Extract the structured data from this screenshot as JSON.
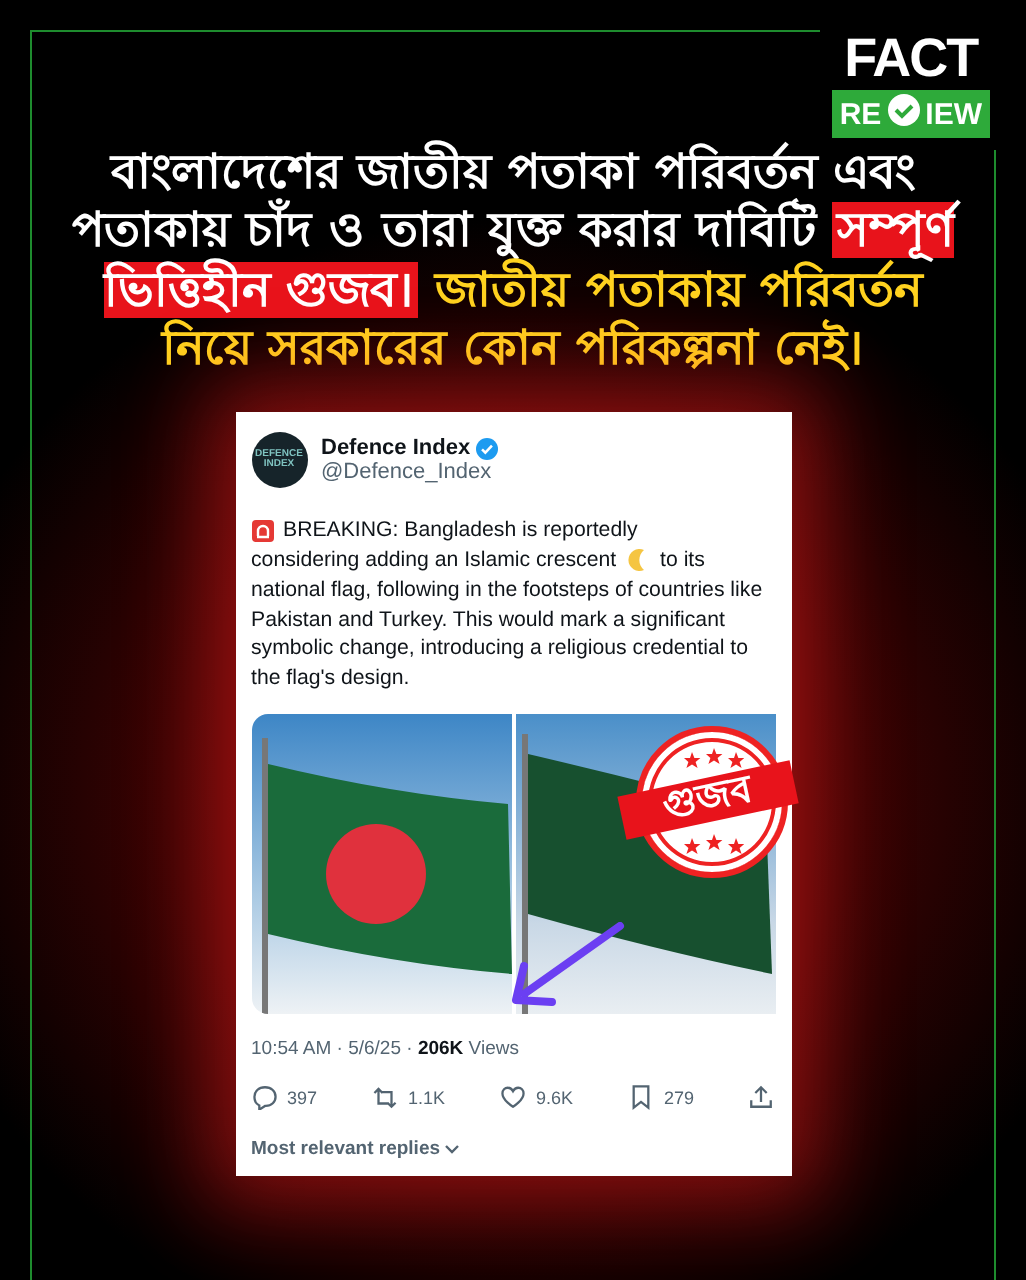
{
  "logo": {
    "top": "FACT",
    "left": "RE",
    "right": "IEW"
  },
  "headline": [
    {
      "kind": "plain",
      "text": "বাংলাদেশের জাতীয় পতাকা পরিবর্তন এবং পতাকায় চাঁদ ও তারা যুক্ত করার দাবিটি "
    },
    {
      "kind": "highlight",
      "text": "সম্পূর্ণ ভিত্তিহীন গুজব।"
    },
    {
      "kind": "accent",
      "text": " জাতীয় পতাকায় পরিবর্তন নিয়ে সরকারের কোন পরিকল্পনা নেই।"
    }
  ],
  "tweet": {
    "avatar_text": "DEFENCE INDEX",
    "name": "Defence Index",
    "verified": true,
    "handle": "@Defence_Index",
    "body": [
      "BREAKING: Bangladesh is reportedly",
      "considering adding an Islamic crescent",
      "to its",
      "national flag, following in the footsteps of countries like Pakistan and Turkey. This would mark a significant symbolic change, introducing a religious credential to the flag's design."
    ],
    "meta": "10:54 AM · 5/6/25 · **206K** Views",
    "actions": [
      {
        "kind": "reply",
        "count": "397"
      },
      {
        "kind": "repost",
        "count": "1.1K"
      },
      {
        "kind": "like",
        "count": "9.6K"
      },
      {
        "kind": "bookmark",
        "count": "279"
      },
      {
        "kind": "share"
      }
    ],
    "replies_sort": "Most relevant replies"
  },
  "stamp": {
    "text": "গুজব"
  }
}
